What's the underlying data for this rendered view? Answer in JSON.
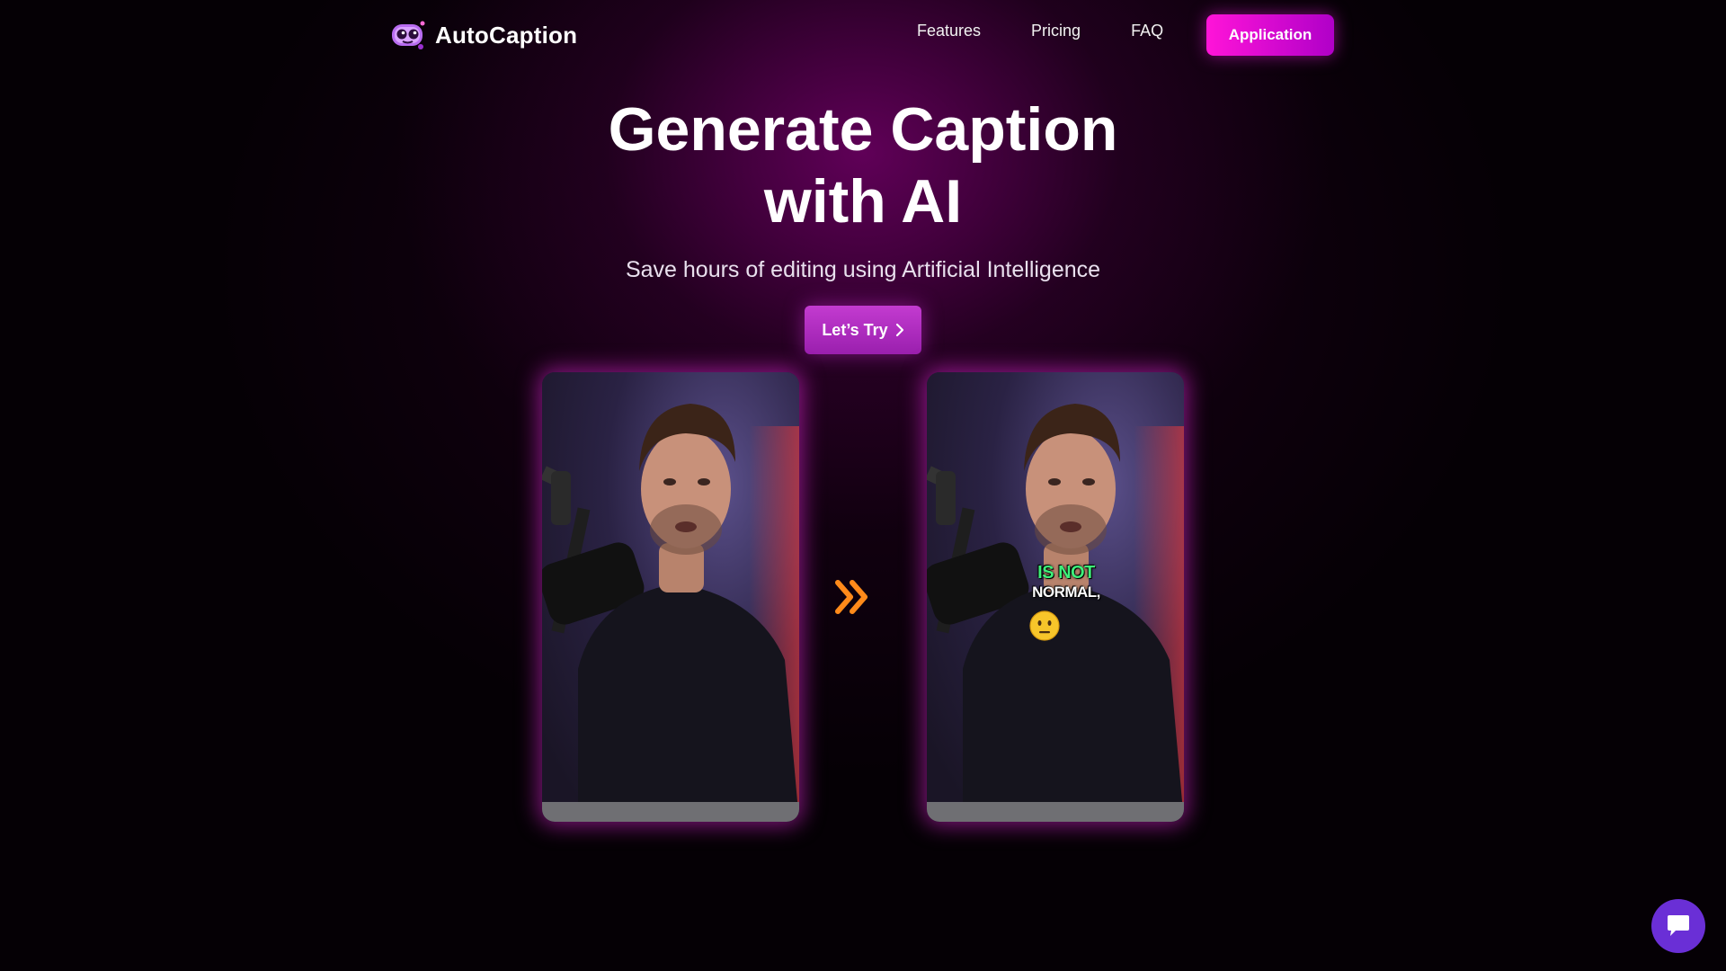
{
  "brand": {
    "name": "AutoCaption",
    "logo_icon": "robot-face-icon"
  },
  "nav": {
    "links": [
      "Features",
      "Pricing",
      "FAQ"
    ],
    "cta_label": "Application"
  },
  "hero": {
    "title_line1": "Generate Caption",
    "title_line2": "with AI",
    "subtitle": "Save hours of editing using Artificial Intelligence",
    "cta_label": "Let’s Try",
    "cta_icon": "chevron-right-icon"
  },
  "comparison": {
    "before_video": "video-frame-without-captions",
    "after_video": "video-frame-with-captions",
    "caption_line1": "IS NOT",
    "caption_line2": "NORMAL,",
    "caption_emoji": "neutral-face-emoji",
    "arrow_icon": "double-chevron-right-icon"
  },
  "chat": {
    "icon": "chat-bubble-icon"
  },
  "colors": {
    "accent": "#e91ad7",
    "cta": "#b12cc4",
    "caption_highlight": "#3ef07a",
    "chat": "#6a2fd6",
    "background": "#050005"
  }
}
